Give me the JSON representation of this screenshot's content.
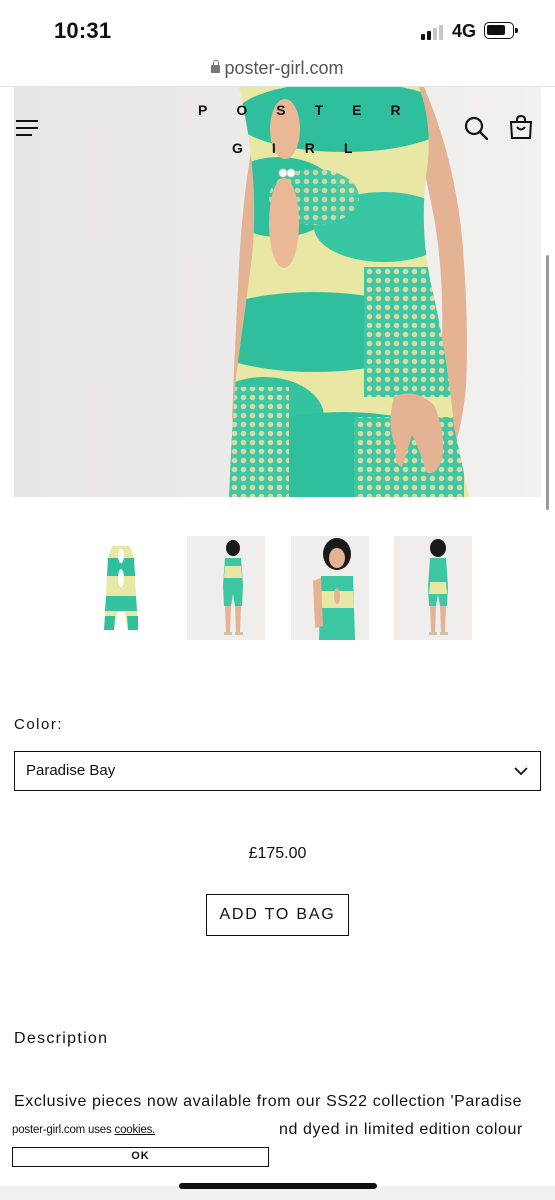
{
  "status_bar": {
    "time": "10:31",
    "network": "4G"
  },
  "browser": {
    "url": "poster-girl.com"
  },
  "header": {
    "logo_line1": "POSTER",
    "logo_line2": "GIRL"
  },
  "product": {
    "color_label": "Color:",
    "color_value": "Paradise Bay",
    "price": "£175.00",
    "add_to_bag": "ADD TO BAG",
    "description_title": "Description",
    "description_line1": "Exclusive pieces now available from our SS22 collection 'Paradise",
    "description_line2": "nd dyed in limited edition colour"
  },
  "cookie": {
    "text": "poster-girl.com uses ",
    "link": "cookies.",
    "ok": "OK"
  },
  "colors": {
    "tie_dye_green": "#2fbf9c",
    "tie_dye_yellow": "#e8e7a3",
    "skin": "#e6b89d",
    "text": "#111111"
  }
}
